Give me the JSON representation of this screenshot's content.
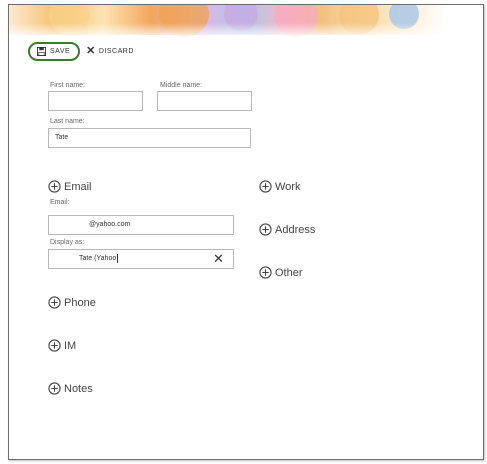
{
  "toolbar": {
    "save_label": "SAVE",
    "discard_label": "DISCARD"
  },
  "name": {
    "first_label": "First name:",
    "first_value": "",
    "middle_label": "Middle name:",
    "middle_value": "",
    "last_label": "Last name:",
    "last_value": "Tate"
  },
  "email": {
    "section_label": "Email",
    "email_label": "Email:",
    "email_value": "@yahoo.com",
    "display_label": "Display as:",
    "display_value": "Tate (Yahoo"
  },
  "sections": {
    "phone": "Phone",
    "im": "IM",
    "notes": "Notes",
    "work": "Work",
    "address": "Address",
    "other": "Other"
  },
  "colors": {
    "save_ring": "#3b7a2a"
  }
}
